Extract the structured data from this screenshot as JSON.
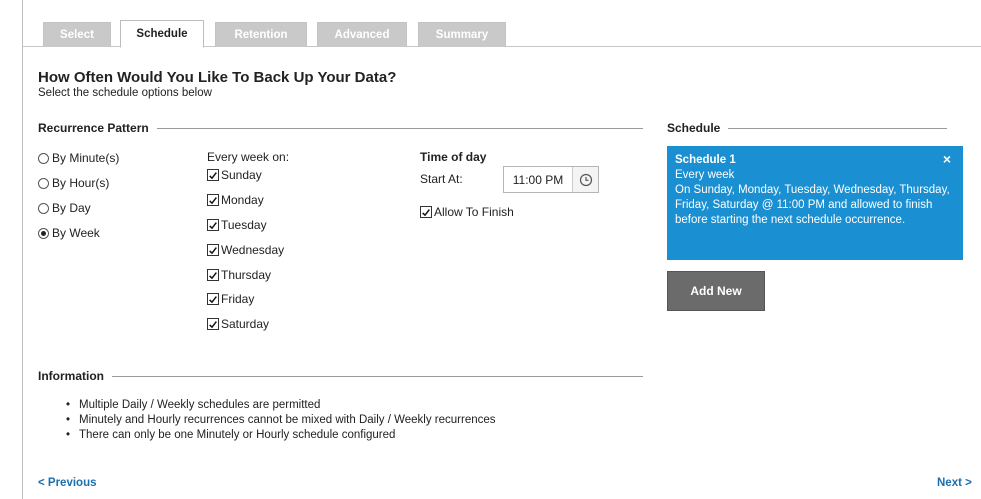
{
  "tabs": [
    {
      "label": "Select",
      "active": false
    },
    {
      "label": "Schedule",
      "active": true
    },
    {
      "label": "Retention",
      "active": false
    },
    {
      "label": "Advanced",
      "active": false
    },
    {
      "label": "Summary",
      "active": false
    }
  ],
  "header": {
    "title": "How Often Would You Like To Back Up Your Data?",
    "subtitle": "Select the schedule options below"
  },
  "recurrence": {
    "heading": "Recurrence Pattern",
    "options": [
      {
        "label": "By Minute(s)",
        "selected": false
      },
      {
        "label": "By Hour(s)",
        "selected": false
      },
      {
        "label": "By Day",
        "selected": false
      },
      {
        "label": "By Week",
        "selected": true
      }
    ],
    "every_week_label": "Every week on:",
    "days": [
      {
        "label": "Sunday",
        "checked": true
      },
      {
        "label": "Monday",
        "checked": true
      },
      {
        "label": "Tuesday",
        "checked": true
      },
      {
        "label": "Wednesday",
        "checked": true
      },
      {
        "label": "Thursday",
        "checked": true
      },
      {
        "label": "Friday",
        "checked": true
      },
      {
        "label": "Saturday",
        "checked": true
      }
    ]
  },
  "time_of_day": {
    "heading": "Time of day",
    "start_label": "Start At:",
    "start_value": "11:00 PM",
    "allow_finish_label": "Allow To Finish",
    "allow_finish_checked": true
  },
  "schedule": {
    "heading": "Schedule",
    "card": {
      "title": "Schedule 1",
      "line1": "Every week",
      "description": "On Sunday, Monday, Tuesday, Wednesday, Thursday, Friday, Saturday @ 11:00 PM and allowed to finish before starting the next schedule occurrence.",
      "close_symbol": "×",
      "color": "#1a8fd1"
    },
    "add_new_label": "Add New"
  },
  "information": {
    "heading": "Information",
    "items": [
      "Multiple Daily / Weekly schedules are permitted",
      "Minutely and Hourly recurrences cannot be mixed with Daily / Weekly recurrences",
      "There can only be one Minutely or Hourly schedule configured"
    ]
  },
  "nav": {
    "previous_label": "< Previous",
    "next_label": "Next >"
  }
}
